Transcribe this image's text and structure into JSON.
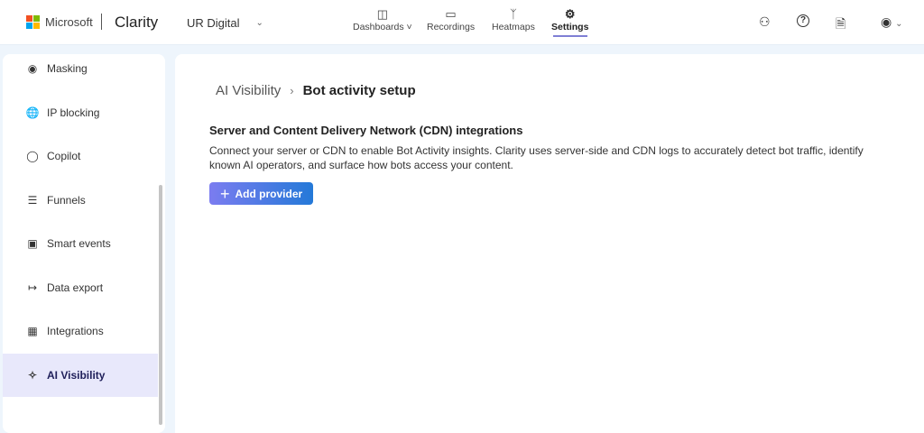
{
  "header": {
    "brand": "Microsoft",
    "product": "Clarity",
    "project": "UR Digital",
    "nav": [
      {
        "label": "Dashboards",
        "icon": "dashboard-icon"
      },
      {
        "label": "Recordings",
        "icon": "video-icon"
      },
      {
        "label": "Heatmaps",
        "icon": "flame-icon"
      },
      {
        "label": "Settings",
        "icon": "gear-icon"
      }
    ]
  },
  "sidebar": {
    "items": [
      {
        "label": "Masking"
      },
      {
        "label": "IP blocking"
      },
      {
        "label": "Copilot"
      },
      {
        "label": "Funnels"
      },
      {
        "label": "Smart events"
      },
      {
        "label": "Data export"
      },
      {
        "label": "Integrations"
      },
      {
        "label": "AI Visibility"
      }
    ]
  },
  "main": {
    "breadcrumb": {
      "parent": "AI Visibility",
      "current": "Bot activity setup"
    },
    "section_title": "Server and Content Delivery Network (CDN) integrations",
    "description": "Connect your server or CDN to enable Bot Activity insights. Clarity uses server-side and CDN logs to accurately detect bot traffic, identify known AI operators, and surface how bots access your content.",
    "add_button": "Add provider"
  },
  "colors": {
    "accent": "#7f7fd5",
    "active_bg": "#e8e8fb",
    "button_start": "#7b7cf0",
    "button_end": "#2479d8"
  }
}
